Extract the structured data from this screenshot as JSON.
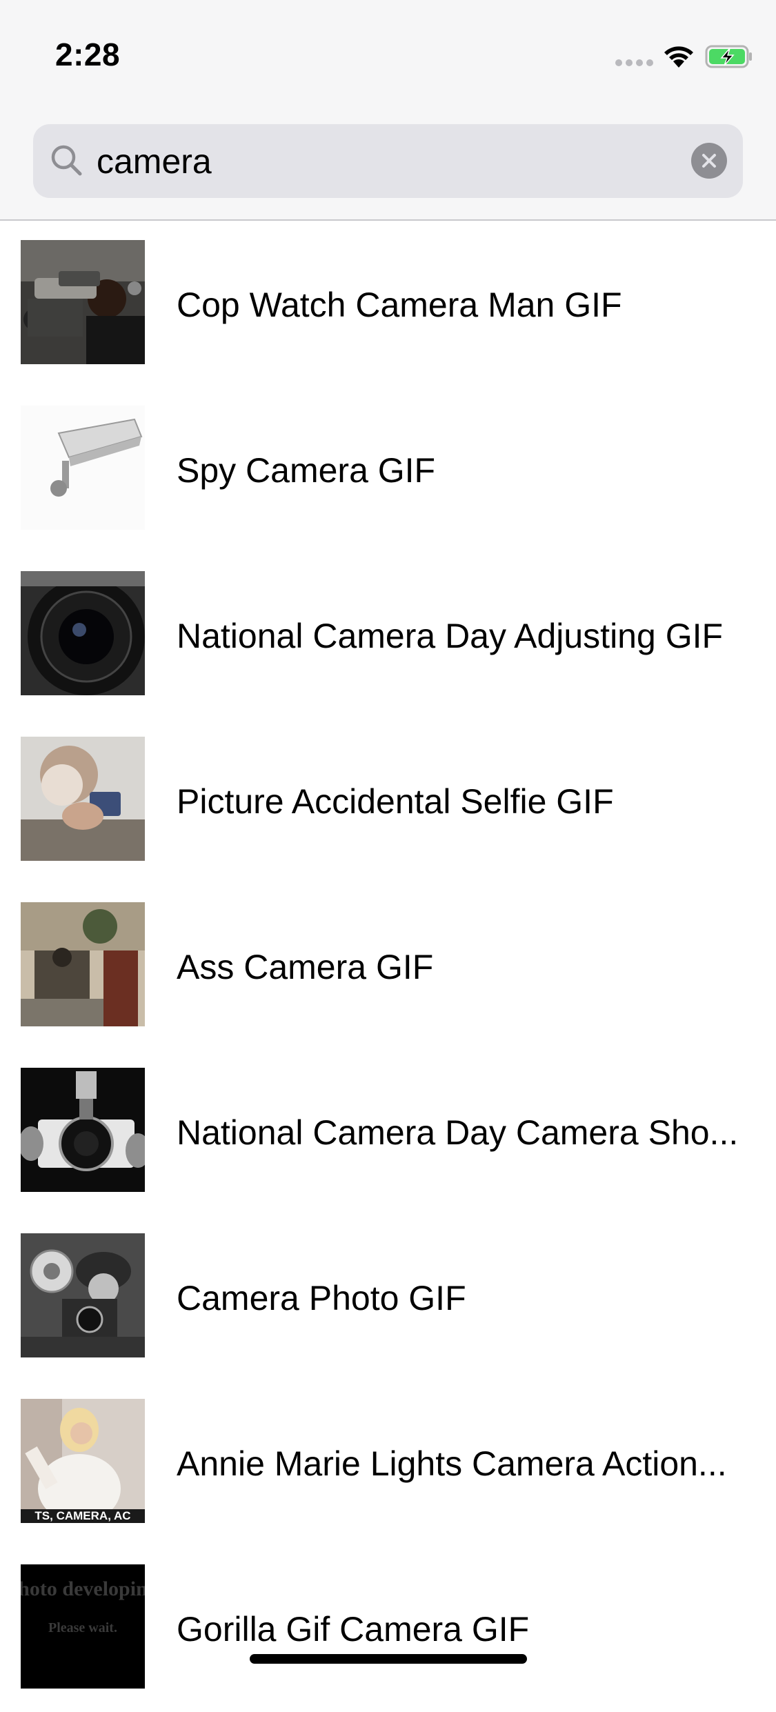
{
  "status_bar": {
    "time": "2:28",
    "icons": [
      "signal-dots-icon",
      "wifi-icon",
      "battery-charging-icon"
    ],
    "battery_color": "#4cd964"
  },
  "search": {
    "icon": "search-icon",
    "value": "camera",
    "clear_icon": "clear-icon"
  },
  "results": [
    {
      "title": "Cop Watch Camera Man GIF",
      "thumb": "camera-man-thumbnail"
    },
    {
      "title": "Spy Camera GIF",
      "thumb": "security-camera-thumbnail"
    },
    {
      "title": "National Camera Day Adjusting GIF",
      "thumb": "camera-lens-thumbnail"
    },
    {
      "title": "Picture Accidental Selfie GIF",
      "thumb": "selfie-thumbnail"
    },
    {
      "title": "Ass Camera GIF",
      "thumb": "photographer-thumbnail"
    },
    {
      "title": "National Camera Day Camera Sho...",
      "thumb": "camera-shot-thumbnail"
    },
    {
      "title": "Camera Photo GIF",
      "thumb": "vintage-camera-thumbnail"
    },
    {
      "title": "Annie Marie Lights Camera Action...",
      "thumb": "annie-marie-thumbnail",
      "thumb_caption": "TS, CAMERA, AC"
    },
    {
      "title": "Gorilla Gif Camera GIF",
      "thumb": "gorilla-gif-thumbnail",
      "thumb_caption_1": "hoto developin",
      "thumb_caption_2": "Please wait."
    }
  ]
}
